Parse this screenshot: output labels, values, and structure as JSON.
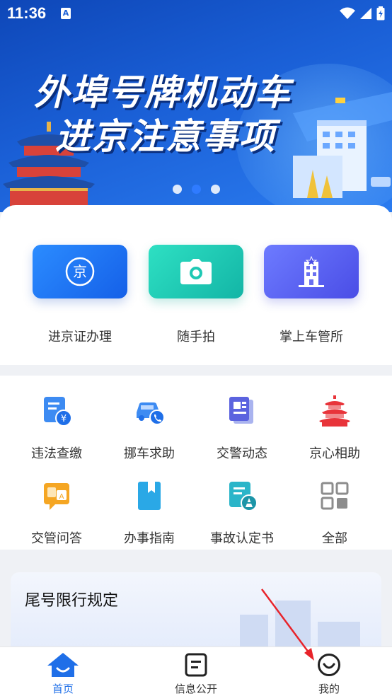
{
  "status_bar": {
    "time": "11:36",
    "notif_glyph": "A"
  },
  "banner": {
    "title_line1": "外埠号牌机动车",
    "title_line2": "进京注意事项",
    "dots": 3,
    "active_dot": 1
  },
  "quick_actions": [
    {
      "label": "进京证办理",
      "icon": "beijing-permit-icon"
    },
    {
      "label": "随手拍",
      "icon": "camera-icon"
    },
    {
      "label": "掌上车管所",
      "icon": "office-building-icon"
    }
  ],
  "services": [
    {
      "label": "违法查缴",
      "icon": "violation-payment-icon"
    },
    {
      "label": "挪车求助",
      "icon": "move-car-icon"
    },
    {
      "label": "交警动态",
      "icon": "police-news-icon"
    },
    {
      "label": "京心相助",
      "icon": "temple-icon"
    },
    {
      "label": "交管问答",
      "icon": "qa-icon"
    },
    {
      "label": "办事指南",
      "icon": "guide-book-icon"
    },
    {
      "label": "事故认定书",
      "icon": "accident-report-icon"
    },
    {
      "label": "全部",
      "icon": "grid-all-icon"
    }
  ],
  "restriction_card": {
    "title": "尾号限行规定"
  },
  "tabs": [
    {
      "label": "首页",
      "icon": "home-icon",
      "active": true
    },
    {
      "label": "信息公开",
      "icon": "document-icon",
      "active": false
    },
    {
      "label": "我的",
      "icon": "smiley-icon",
      "active": false
    }
  ],
  "colors": {
    "primary": "#1f6fe8",
    "banner_dark": "#0e47b8",
    "accent_red": "#e8343a",
    "accent_orange": "#f5a623"
  }
}
